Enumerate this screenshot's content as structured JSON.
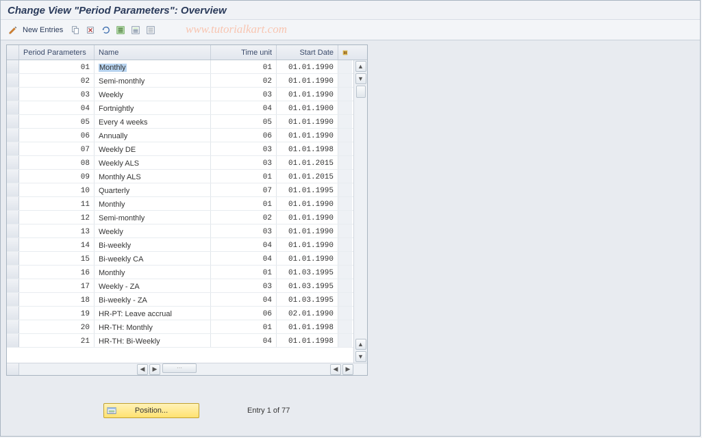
{
  "title": "Change View \"Period Parameters\": Overview",
  "watermark": "www.tutorialkart.com",
  "toolbar": {
    "new_entries_label": "New Entries"
  },
  "columns": {
    "c0": "Period Parameters",
    "c1": "Name",
    "c2": "Time unit",
    "c3": "Start Date"
  },
  "rows": [
    {
      "pp": "01",
      "name": "Monthly",
      "tu": "01",
      "sd": "01.01.1990",
      "selected": true
    },
    {
      "pp": "02",
      "name": "Semi-monthly",
      "tu": "02",
      "sd": "01.01.1990"
    },
    {
      "pp": "03",
      "name": "Weekly",
      "tu": "03",
      "sd": "01.01.1990"
    },
    {
      "pp": "04",
      "name": "Fortnightly",
      "tu": "04",
      "sd": "01.01.1900"
    },
    {
      "pp": "05",
      "name": "Every 4 weeks",
      "tu": "05",
      "sd": "01.01.1990"
    },
    {
      "pp": "06",
      "name": "Annually",
      "tu": "06",
      "sd": "01.01.1990"
    },
    {
      "pp": "07",
      "name": "Weekly  DE",
      "tu": "03",
      "sd": "01.01.1998"
    },
    {
      "pp": "08",
      "name": "Weekly ALS",
      "tu": "03",
      "sd": "01.01.2015"
    },
    {
      "pp": "09",
      "name": "Monthly ALS",
      "tu": "01",
      "sd": "01.01.2015"
    },
    {
      "pp": "10",
      "name": "Quarterly",
      "tu": "07",
      "sd": "01.01.1995"
    },
    {
      "pp": "11",
      "name": "Monthly",
      "tu": "01",
      "sd": "01.01.1990"
    },
    {
      "pp": "12",
      "name": "Semi-monthly",
      "tu": "02",
      "sd": "01.01.1990"
    },
    {
      "pp": "13",
      "name": "Weekly",
      "tu": "03",
      "sd": "01.01.1990"
    },
    {
      "pp": "14",
      "name": "Bi-weekly",
      "tu": "04",
      "sd": "01.01.1990"
    },
    {
      "pp": "15",
      "name": "Bi-weekly CA",
      "tu": "04",
      "sd": "01.01.1990"
    },
    {
      "pp": "16",
      "name": "Monthly",
      "tu": "01",
      "sd": "01.03.1995"
    },
    {
      "pp": "17",
      "name": "Weekly - ZA",
      "tu": "03",
      "sd": "01.03.1995"
    },
    {
      "pp": "18",
      "name": "Bi-weekly - ZA",
      "tu": "04",
      "sd": "01.03.1995"
    },
    {
      "pp": "19",
      "name": "HR-PT: Leave accrual",
      "tu": "06",
      "sd": "02.01.1990"
    },
    {
      "pp": "20",
      "name": "HR-TH: Monthly",
      "tu": "01",
      "sd": "01.01.1998"
    },
    {
      "pp": "21",
      "name": "HR-TH: Bi-Weekly",
      "tu": "04",
      "sd": "01.01.1998"
    }
  ],
  "footer": {
    "position_label": "Position...",
    "entry_status": "Entry 1 of 77"
  }
}
